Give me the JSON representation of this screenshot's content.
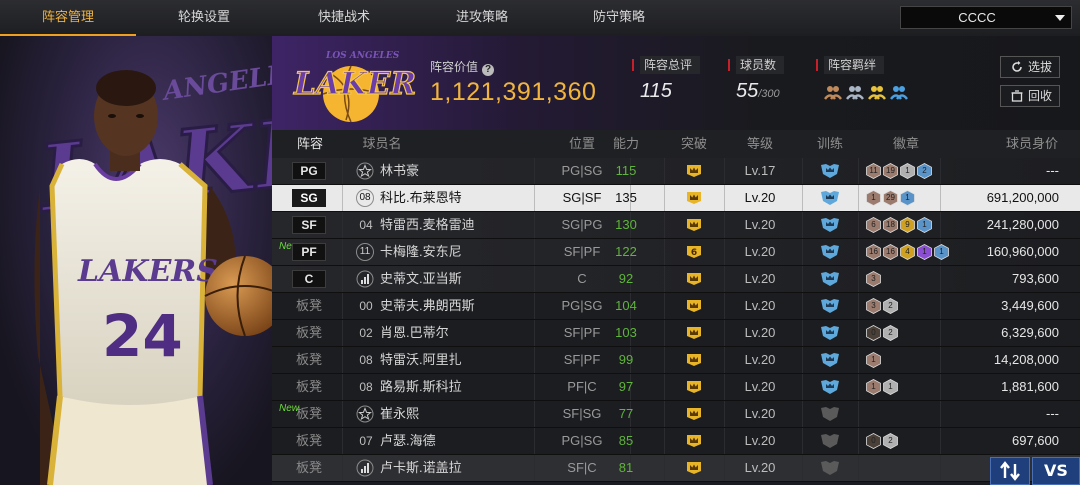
{
  "tabs": [
    {
      "label": "阵容管理",
      "active": true
    },
    {
      "label": "轮换设置",
      "active": false
    },
    {
      "label": "快捷战术",
      "active": false
    },
    {
      "label": "进攻策略",
      "active": false
    },
    {
      "label": "防守策略",
      "active": false
    }
  ],
  "team_select": {
    "value": "CCCC"
  },
  "player_art": {
    "jersey_text": "LAKERS",
    "jersey_number": "24",
    "bg_text": "LOS ANGELES"
  },
  "header": {
    "logo_text": "LAKERS",
    "logo_top_text": "LOS ANGELES",
    "lineup_value_label": "阵容价值",
    "lineup_value": "1,121,391,360",
    "rating_label": "阵容总评",
    "rating_value": "115",
    "players_label": "球员数",
    "players_value": "55",
    "players_max": "/300",
    "chemistry_label": "阵容羁绊",
    "select_button": "选拔",
    "recycle_button": "回收"
  },
  "columns": {
    "lineup": "阵容",
    "player": "球员名",
    "position": "位置",
    "ability": "能力",
    "breakthrough": "突破",
    "level": "等级",
    "training": "训练",
    "badge": "徽章",
    "worth": "球员身价"
  },
  "colors": {
    "accent": "#f0a020",
    "ability_green": "#5fb43b",
    "new_green": "#6bdc3a",
    "lakers_purple": "#552583",
    "lakers_gold": "#fdb927"
  },
  "rows": [
    {
      "slot": "PG",
      "bench": false,
      "new": false,
      "jersey": "",
      "jersey_icon": "star-icon",
      "name": "林书豪",
      "pos": "PG|SG",
      "ability": "115",
      "crown": "crown-icon",
      "level": "Lv.17",
      "train": "blue",
      "badges": [
        {
          "c": "#9a7b6d",
          "t": "11"
        },
        {
          "c": "#9a7b6d",
          "t": "19"
        },
        {
          "c": "#b0b0b0",
          "t": "1"
        },
        {
          "c": "#5a93c8",
          "t": "2"
        }
      ],
      "worth": "---"
    },
    {
      "slot": "SG",
      "bench": false,
      "new": false,
      "selected": true,
      "jersey": "08",
      "jersey_icon": "",
      "name": "科比.布莱恩特",
      "pos": "SG|SF",
      "ability": "135",
      "crown": "crown-icon",
      "level": "Lv.20",
      "train": "blue",
      "badges": [
        {
          "c": "#9a7b6d",
          "t": "1"
        },
        {
          "c": "#9a7b6d",
          "t": "29"
        },
        {
          "c": "#5a93c8",
          "t": "1"
        }
      ],
      "worth": "691,200,000"
    },
    {
      "slot": "SF",
      "bench": false,
      "new": false,
      "jersey": "04",
      "jersey_icon": "",
      "name": "特雷西.麦格雷迪",
      "pos": "SG|PG",
      "ability": "130",
      "crown": "crown-icon",
      "level": "Lv.20",
      "train": "blue",
      "badges": [
        {
          "c": "#9a7b6d",
          "t": "6"
        },
        {
          "c": "#9a7b6d",
          "t": "18"
        },
        {
          "c": "#d0a020",
          "t": "9"
        },
        {
          "c": "#5a93c8",
          "t": "1"
        }
      ],
      "worth": "241,280,000"
    },
    {
      "slot": "PF",
      "bench": false,
      "new": true,
      "new_label": "New",
      "jersey": "11",
      "jersey_icon": "",
      "name": "卡梅隆.安东尼",
      "pos": "SF|PF",
      "ability": "122",
      "crown": "crown-6",
      "level": "Lv.20",
      "train": "blue",
      "badges": [
        {
          "c": "#9a7b6d",
          "t": "16"
        },
        {
          "c": "#9a7b6d",
          "t": "16"
        },
        {
          "c": "#d0a020",
          "t": "4"
        },
        {
          "c": "#8a4fd0",
          "t": "1"
        },
        {
          "c": "#5a93c8",
          "t": "1"
        }
      ],
      "worth": "160,960,000"
    },
    {
      "slot": "C",
      "bench": false,
      "new": false,
      "jersey": "",
      "jersey_icon": "signal-icon",
      "name": "史蒂文.亚当斯",
      "pos": "C",
      "ability": "92",
      "crown": "crown-icon",
      "level": "Lv.20",
      "train": "blue",
      "badges": [
        {
          "c": "#9a7b6d",
          "t": "3"
        }
      ],
      "worth": "793,600"
    },
    {
      "slot": "板凳",
      "bench": true,
      "new": false,
      "jersey": "00",
      "jersey_icon": "",
      "name": "史蒂夫.弗朗西斯",
      "pos": "PG|SG",
      "ability": "104",
      "crown": "crown-icon",
      "level": "Lv.20",
      "train": "blue",
      "badges": [
        {
          "c": "#9a7b6d",
          "t": "3"
        },
        {
          "c": "#b0b0b0",
          "t": "2"
        }
      ],
      "worth": "3,449,600"
    },
    {
      "slot": "板凳",
      "bench": true,
      "new": false,
      "jersey": "02",
      "jersey_icon": "",
      "name": "肖恩.巴蒂尔",
      "pos": "SF|PF",
      "ability": "103",
      "crown": "crown-icon",
      "level": "Lv.20",
      "train": "blue",
      "badges": [
        {
          "c": "#4a4038",
          "t": "0"
        },
        {
          "c": "#b0b0b0",
          "t": "2"
        }
      ],
      "worth": "6,329,600"
    },
    {
      "slot": "板凳",
      "bench": true,
      "new": false,
      "jersey": "08",
      "jersey_icon": "",
      "name": "特雷沃.阿里扎",
      "pos": "SF|PF",
      "ability": "99",
      "crown": "crown-icon",
      "level": "Lv.20",
      "train": "blue",
      "badges": [
        {
          "c": "#9a7b6d",
          "t": "1"
        }
      ],
      "worth": "14,208,000"
    },
    {
      "slot": "板凳",
      "bench": true,
      "new": false,
      "jersey": "08",
      "jersey_icon": "",
      "name": "路易斯.斯科拉",
      "pos": "PF|C",
      "ability": "97",
      "crown": "crown-icon",
      "level": "Lv.20",
      "train": "blue",
      "badges": [
        {
          "c": "#9a7b6d",
          "t": "1"
        },
        {
          "c": "#b0b0b0",
          "t": "1"
        }
      ],
      "worth": "1,881,600"
    },
    {
      "slot": "板凳",
      "bench": true,
      "new": true,
      "new_label": "New",
      "jersey": "",
      "jersey_icon": "star-icon",
      "name": "崔永熙",
      "pos": "SF|SG",
      "ability": "77",
      "crown": "crown-icon",
      "level": "Lv.20",
      "train": "gray",
      "badges": [],
      "worth": "---"
    },
    {
      "slot": "板凳",
      "bench": true,
      "new": false,
      "jersey": "07",
      "jersey_icon": "",
      "name": "卢瑟.海德",
      "pos": "PG|SG",
      "ability": "85",
      "crown": "crown-icon",
      "level": "Lv.20",
      "train": "gray",
      "badges": [
        {
          "c": "#4a4038",
          "t": "0"
        },
        {
          "c": "#b0b0b0",
          "t": "2"
        }
      ],
      "worth": "697,600"
    },
    {
      "slot": "板凳",
      "bench": true,
      "new": false,
      "dim": true,
      "jersey": "",
      "jersey_icon": "signal-icon",
      "name": "卢卡斯.诺盖拉",
      "pos": "SF|C",
      "ability": "81",
      "crown": "crown-icon",
      "level": "Lv.20",
      "train": "gray",
      "badges": [],
      "worth": ""
    }
  ],
  "footer": {
    "vs_label": "VS",
    "swap_icon": "swap-arrows-icon"
  }
}
